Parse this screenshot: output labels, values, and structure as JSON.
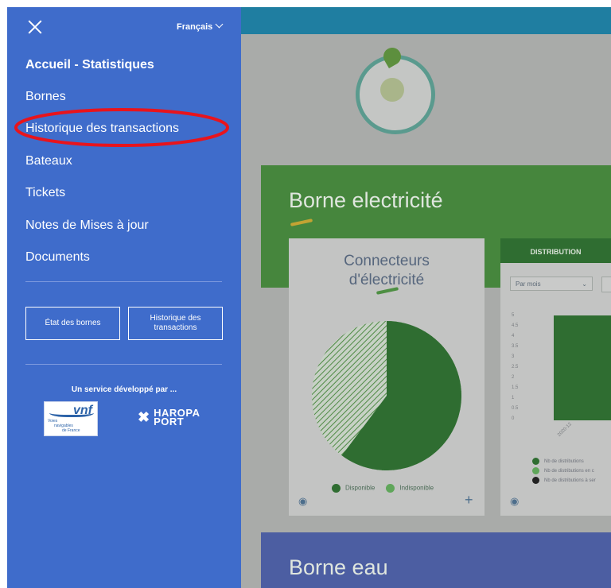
{
  "background": {
    "section_electricity": {
      "title": "Borne electricité",
      "connectors_card": {
        "title_line1": "Connecteurs",
        "title_line2": "d'électricité",
        "legend": [
          "Disponible",
          "Indisponible"
        ],
        "eye_icon": "eye-icon",
        "plus_icon": "plus-icon"
      },
      "distribution_card": {
        "header": "DISTRIBUTION",
        "period_select": "Par mois",
        "y_ticks": [
          "5",
          "4.5",
          "4",
          "3.5",
          "3",
          "2.5",
          "2",
          "1.5",
          "1",
          "0.5",
          "0"
        ],
        "x_tick": "2020-12",
        "legend": [
          "Nb de distributions",
          "Nb de distributions en c",
          "Nb de distributions à ser"
        ]
      }
    },
    "section_water": {
      "title": "Borne eau"
    }
  },
  "sidebar": {
    "language": "Français",
    "items": [
      {
        "label": "Accueil - Statistiques"
      },
      {
        "label": "Bornes"
      },
      {
        "label": "Historique des transactions"
      },
      {
        "label": "Bateaux"
      },
      {
        "label": "Tickets"
      },
      {
        "label": "Notes de Mises à jour"
      },
      {
        "label": "Documents"
      }
    ],
    "buttons": {
      "state": "État des bornes",
      "history_line1": "Historique des",
      "history_line2": "transactions"
    },
    "service_text": "Un service développé par ...",
    "partners": {
      "vnf": "vnf",
      "vnf_sub_line1": "Voies",
      "vnf_sub_line2": "navigables",
      "vnf_sub_line3": "de France",
      "haropa_line1": "HAROPA",
      "haropa_line2": "PORT"
    }
  },
  "colors": {
    "sidebar": "#3f6ccb",
    "annotation": "#e8141c"
  }
}
